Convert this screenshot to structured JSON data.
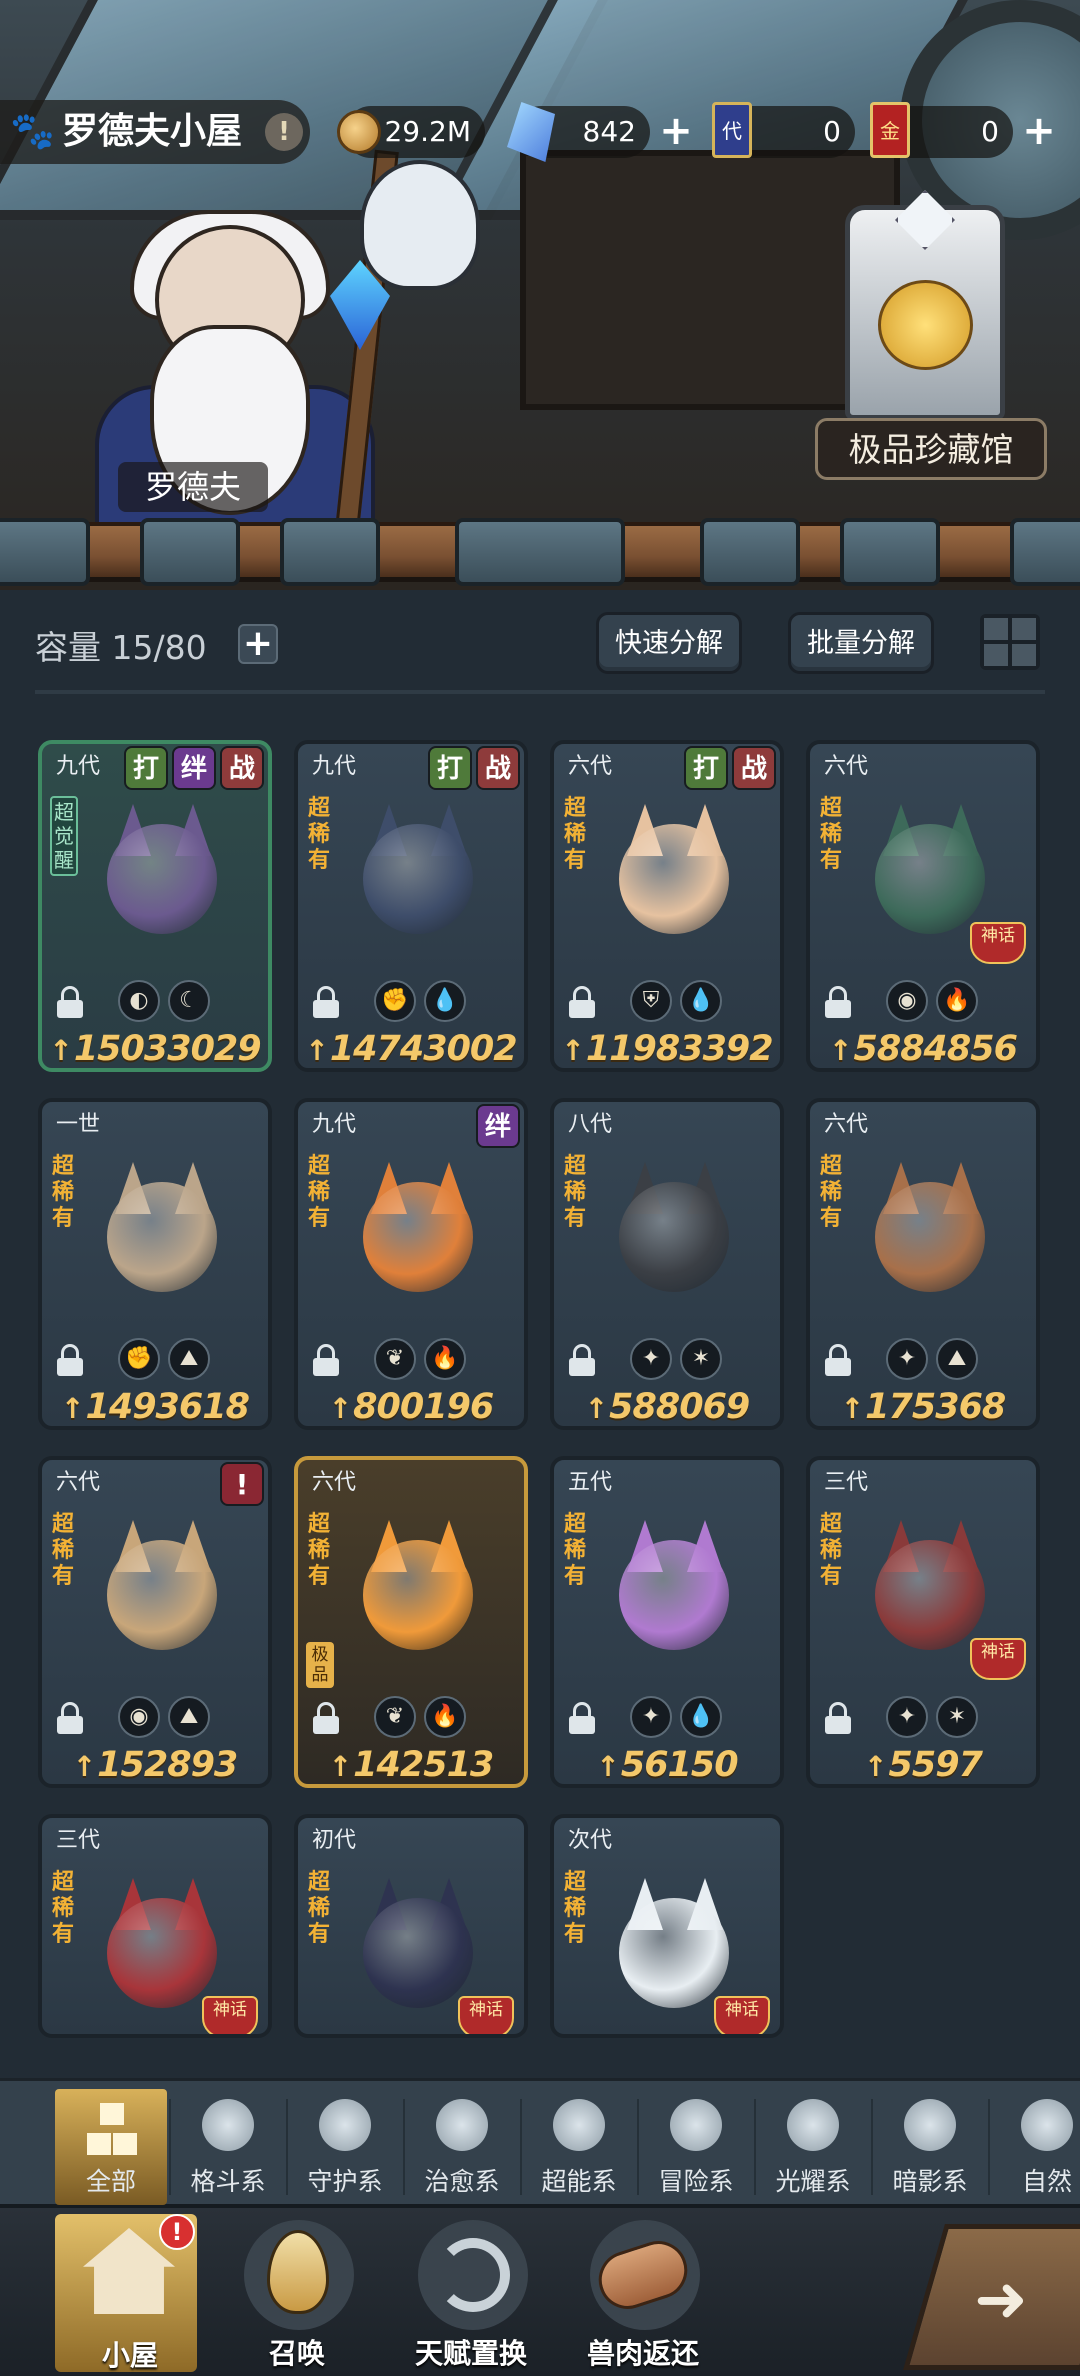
{
  "location": {
    "title": "罗德夫小屋",
    "info_icon": "!",
    "npc_name": "罗德夫",
    "museum_button": "极品珍藏馆"
  },
  "resources": [
    {
      "icon": "gold-coin",
      "value": "29.2M",
      "has_plus": false
    },
    {
      "icon": "crystal",
      "value": "842",
      "has_plus": true
    },
    {
      "icon": "ticket-dai",
      "icon_text": "代",
      "value": "0",
      "has_plus": false
    },
    {
      "icon": "ticket-jin",
      "icon_text": "金",
      "value": "0",
      "has_plus": true
    }
  ],
  "plus_symbol": "+",
  "capacity": {
    "label": "容量 15/80",
    "add": "+"
  },
  "actions": {
    "quick_decompose": "快速分解",
    "batch_decompose": "批量分解"
  },
  "tag_text": {
    "fight": "打",
    "bond": "绊",
    "war": "战",
    "alert": "!"
  },
  "rarity_text": "超稀有",
  "awaken_text": "超觉醒",
  "jipin_text": "极品",
  "mythic_text": "神话",
  "power_prefix": "↑",
  "cards": [
    {
      "gen": "九代",
      "tags": [
        "fight",
        "bond",
        "war"
      ],
      "awaken": true,
      "elements": [
        "shadow",
        "dark"
      ],
      "power": "15033029",
      "color": "#6b5a8f"
    },
    {
      "gen": "九代",
      "tags": [
        "fight",
        "war"
      ],
      "rarity": true,
      "elements": [
        "fighting",
        "water"
      ],
      "power": "14743002",
      "color": "#3e4d6a"
    },
    {
      "gen": "六代",
      "tags": [
        "fight",
        "war"
      ],
      "rarity": true,
      "elements": [
        "guard",
        "water"
      ],
      "power": "11983392",
      "color": "#e6c2a0"
    },
    {
      "gen": "六代",
      "tags": [],
      "rarity": true,
      "mythic": true,
      "elements": [
        "psychic",
        "fire"
      ],
      "power": "5884856",
      "color": "#3d6a5a"
    },
    {
      "gen": "一世",
      "tags": [],
      "rarity": true,
      "elements": [
        "fighting",
        "adventure"
      ],
      "power": "1493618",
      "color": "#bba58a"
    },
    {
      "gen": "九代",
      "tags": [
        "bond"
      ],
      "rarity": true,
      "elements": [
        "heal",
        "fire"
      ],
      "power": "800196",
      "color": "#e0803a"
    },
    {
      "gen": "八代",
      "tags": [],
      "rarity": true,
      "elements": [
        "light",
        "star"
      ],
      "power": "588069",
      "color": "#3b3f45"
    },
    {
      "gen": "六代",
      "tags": [],
      "rarity": true,
      "elements": [
        "light",
        "adventure"
      ],
      "power": "175368",
      "color": "#a8704a"
    },
    {
      "gen": "六代",
      "tags": [
        "alert"
      ],
      "rarity": true,
      "elements": [
        "psychic",
        "adventure"
      ],
      "power": "152893",
      "color": "#c8a67a"
    },
    {
      "gen": "六代",
      "tags": [],
      "rarity": true,
      "jipin": true,
      "gold": true,
      "elements": [
        "heal",
        "fire"
      ],
      "power": "142513",
      "color": "#f09a3a"
    },
    {
      "gen": "五代",
      "tags": [],
      "rarity": true,
      "elements": [
        "light",
        "water"
      ],
      "power": "56150",
      "color": "#b07ad0"
    },
    {
      "gen": "三代",
      "tags": [],
      "rarity": true,
      "mythic": true,
      "elements": [
        "light",
        "star"
      ],
      "power": "5597",
      "color": "#8a3a3a"
    },
    {
      "gen": "三代",
      "tags": [],
      "rarity": true,
      "mythic": true,
      "elements": [],
      "power": "",
      "color": "#a8353a"
    },
    {
      "gen": "初代",
      "tags": [],
      "rarity": true,
      "mythic": true,
      "elements": [],
      "power": "",
      "color": "#2e3350"
    },
    {
      "gen": "次代",
      "tags": [],
      "rarity": true,
      "mythic": true,
      "elements": [],
      "power": "",
      "color": "#e8eef2"
    }
  ],
  "filters": [
    {
      "label": "全部",
      "icon": "all-icon",
      "active": true
    },
    {
      "label": "格斗系",
      "icon": "fist-icon"
    },
    {
      "label": "守护系",
      "icon": "shield-icon"
    },
    {
      "label": "治愈系",
      "icon": "sprout-icon"
    },
    {
      "label": "超能系",
      "icon": "alien-icon"
    },
    {
      "label": "冒险系",
      "icon": "lantern-icon"
    },
    {
      "label": "光耀系",
      "icon": "sparkle-icon"
    },
    {
      "label": "暗影系",
      "icon": "eclipse-icon"
    },
    {
      "label": "自然",
      "icon": "leaf-icon"
    }
  ],
  "nav": [
    {
      "label": "小屋",
      "icon": "house-icon",
      "active": true,
      "badge": "!"
    },
    {
      "label": "召唤",
      "icon": "egg-icon"
    },
    {
      "label": "天赋置换",
      "icon": "swap-icon"
    },
    {
      "label": "兽肉返还",
      "icon": "meat-icon"
    }
  ],
  "element_glyphs": {
    "shadow": "◐",
    "dark": "☾",
    "fighting": "✊",
    "water": "💧",
    "guard": "⛨",
    "psychic": "◉",
    "fire": "🔥",
    "adventure": "⛰",
    "heal": "❦",
    "light": "✦",
    "star": "✶"
  },
  "colors": {
    "accent_gold": "#f4c86a",
    "rarity_orange": "#f3b235",
    "panel": "#222c35"
  }
}
